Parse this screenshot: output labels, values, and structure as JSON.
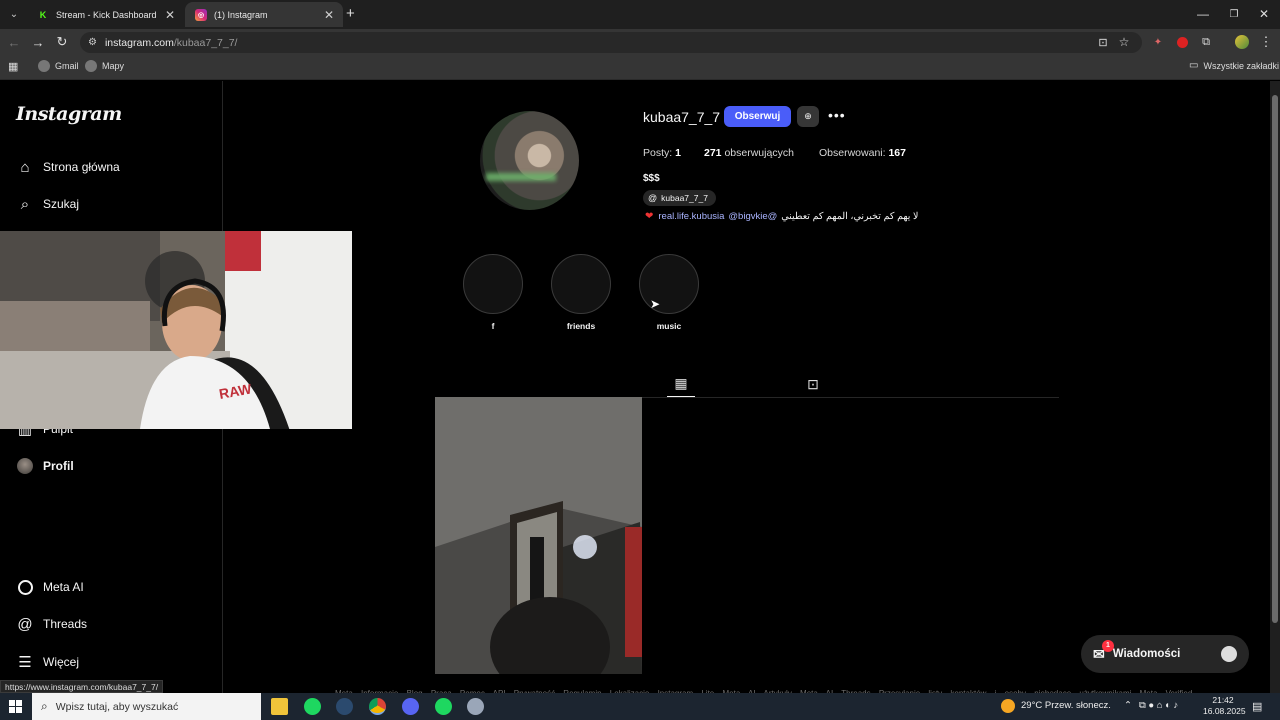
{
  "browser": {
    "tabs": [
      {
        "title": "Stream - Kick Dashboard",
        "active": false
      },
      {
        "title": "(1) Instagram",
        "active": true
      }
    ],
    "address": {
      "domain": "instagram.com",
      "path": "/kubaa7_7_7/"
    },
    "bookmarks": [
      "Gmail",
      "Mapy"
    ],
    "all_bookmarks_label": "Wszystkie zakładki",
    "status_url": "https://www.instagram.com/kubaa7_7_7/"
  },
  "sidebar": {
    "logo": "Instagram",
    "items": [
      {
        "label": "Strona główna",
        "icon": "home-icon"
      },
      {
        "label": "Szukaj",
        "icon": "search-icon"
      },
      {
        "label": "Pulpit",
        "icon": "dashboard-icon"
      },
      {
        "label": "Profil",
        "icon": "avatar"
      },
      {
        "label": "Meta AI",
        "icon": "meta-ai-icon"
      },
      {
        "label": "Threads",
        "icon": "threads-icon"
      },
      {
        "label": "Więcej",
        "icon": "menu-icon"
      }
    ]
  },
  "profile": {
    "username": "kubaa7_7_7",
    "follow_label": "Obserwuj",
    "stats": {
      "posts_label": "Posty:",
      "posts": "1",
      "followers": "271",
      "followers_label": "obserwujących",
      "following_label": "Obserwowani:",
      "following": "167"
    },
    "bio": "$$$",
    "threads_handle": "kubaa7_7_7",
    "links": {
      "mention1": "real.life.kubusia",
      "mention2": "@bigvkie@",
      "arabic": "لا يهم كم تخبرني، المهم كم تعطيني"
    },
    "highlights": [
      "f",
      "friends",
      "music"
    ]
  },
  "footer": "Meta Informacje Blog Praca Pomoc API Prywatność Regulamin Lokalizacje Instagram Lite Meta AI Artykuły Meta AI Threads Przesyłanie listy kontaktów i osoby niebędące użytkownikami Meta Verified",
  "messages": {
    "label": "Wiadomości",
    "badge": "1"
  },
  "taskbar": {
    "search_placeholder": "Wpisz tutaj, aby wyszukać",
    "weather": "29°C  Przew. słonecz.",
    "time": "21:42",
    "date": "16.08.2025"
  },
  "colors": {
    "accent": "#4a5df9",
    "kick_green": "#53fc18",
    "link": "#aab4ff"
  }
}
